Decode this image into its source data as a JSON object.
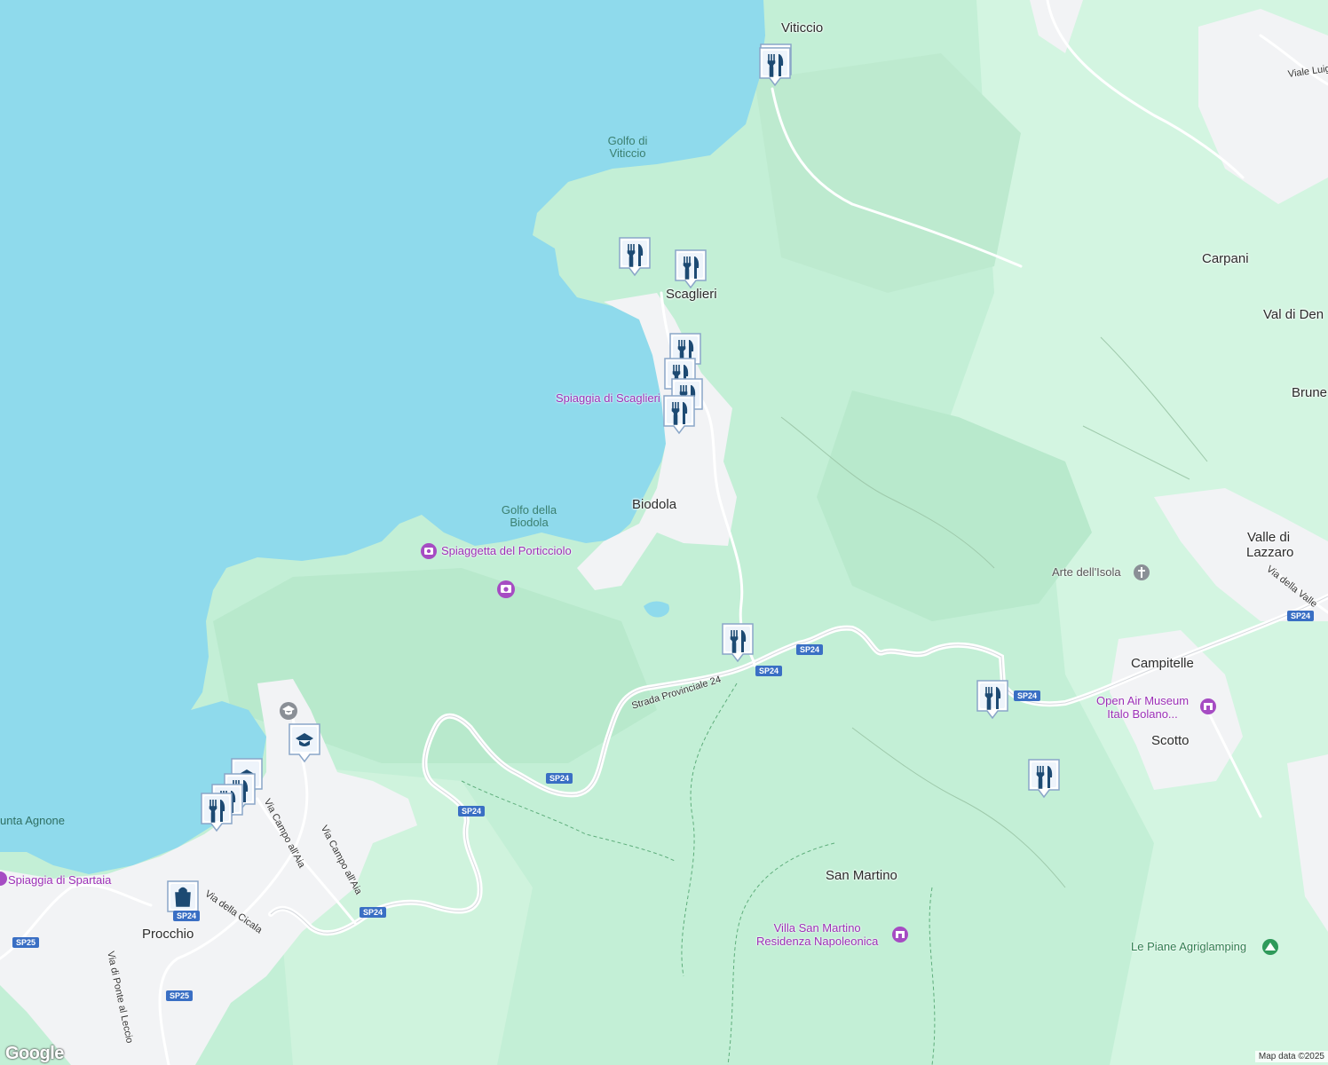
{
  "map": {
    "places": [
      {
        "name": "Viticcio",
        "id": "viticcio"
      },
      {
        "name": "Scaglieri",
        "id": "scaglieri"
      },
      {
        "name": "Biodola",
        "id": "biodola"
      },
      {
        "name": "Carpani",
        "id": "carpani"
      },
      {
        "name": "Val di Den",
        "id": "val-di-den"
      },
      {
        "name": "Brune",
        "id": "brune"
      },
      {
        "name": "Valle di",
        "id": "valle-di-1"
      },
      {
        "name": "Lazzaro",
        "id": "lazzaro"
      },
      {
        "name": "Campitelle",
        "id": "campitelle"
      },
      {
        "name": "Scotto",
        "id": "scotto"
      },
      {
        "name": "San Martino",
        "id": "san-martino"
      },
      {
        "name": "Procchio",
        "id": "procchio"
      }
    ],
    "water": [
      {
        "line1": "Golfo di",
        "line2": "Viticcio"
      },
      {
        "line1": "Golfo della",
        "line2": "Biodola"
      },
      {
        "line1": "unta Agnone",
        "line2": ""
      }
    ],
    "pois": {
      "spiaggia_scaglieri": "Spiaggia di Scaglieri",
      "spiaggetta": "Spiaggetta del Porticciolo",
      "spiaggia_spartaia": "Spiaggia di Spartaia",
      "arte_isola": "Arte dell'Isola",
      "museum_line1": "Open Air Museum",
      "museum_line2": "Italo Bolano...",
      "villa_line1": "Villa San Martino",
      "villa_line2": "Residenza Napoleonica",
      "agriglamping": "Le Piane Agriglamping"
    },
    "streets": {
      "sp24_name": "Strada Provinciale 24",
      "campo_aia_1": "Via Campo all'Aia",
      "campo_aia_2": "Via Campo all'Aia",
      "cicala": "Via della Cicala",
      "ponte_leccio": "Via di Ponte al Leccio",
      "viale_luigi": "Viale Luig",
      "via_valle": "Via della Valle"
    },
    "shields": {
      "sp24": "SP24",
      "sp25": "SP25"
    },
    "colors": {
      "sea": "#8fdaec",
      "land": "#c3efd6",
      "forest": "#b5e8c9",
      "urban": "#f2f3f5",
      "marker": "#1d4a73"
    },
    "markers": [
      {
        "icon": "restaurant-icon"
      },
      {
        "icon": "restaurant-icon"
      },
      {
        "icon": "restaurant-icon"
      },
      {
        "icon": "restaurant-icon"
      },
      {
        "icon": "restaurant-icon"
      },
      {
        "icon": "restaurant-icon"
      },
      {
        "icon": "restaurant-icon"
      },
      {
        "icon": "restaurant-icon"
      },
      {
        "icon": "restaurant-icon"
      },
      {
        "icon": "restaurant-icon"
      },
      {
        "icon": "restaurant-icon"
      },
      {
        "icon": "restaurant-icon"
      },
      {
        "icon": "restaurant-icon"
      },
      {
        "icon": "school-icon"
      },
      {
        "icon": "school-icon"
      },
      {
        "icon": "shopping-bag-icon"
      }
    ],
    "attribution": "Map data ©2025",
    "logo": "Google"
  }
}
